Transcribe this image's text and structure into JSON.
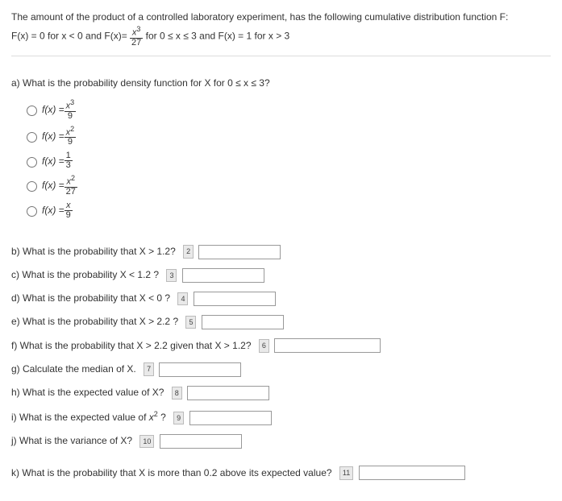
{
  "intro": {
    "line1": "The amount of the product of a controlled laboratory experiment, has the following cumulative distribution function F:",
    "line2_pre": "F(x) = 0 for x < 0 and F(x)= ",
    "line2_mid": " for 0 ≤ x ≤ 3 and F(x) = 1 for x > 3"
  },
  "a": {
    "prompt": "a) What is the probability density function for X for 0 ≤ x ≤ 3?",
    "prefix": "f(x) = "
  },
  "b": {
    "prompt": "b) What is the probability that X > 1.2?",
    "n": "2"
  },
  "c": {
    "prompt": "c) What is the probability X < 1.2 ?",
    "n": "3"
  },
  "d": {
    "prompt": "d) What is the probability that X < 0 ?",
    "n": "4"
  },
  "e": {
    "prompt": "e) What is the probability that X > 2.2 ?",
    "n": "5"
  },
  "f": {
    "prompt": "f) What is the probability that X > 2.2 given that X > 1.2?",
    "n": "6"
  },
  "g": {
    "prompt": "g) Calculate the median of X.",
    "n": "7"
  },
  "h": {
    "prompt": "h) What is the expected value of X?",
    "n": "8"
  },
  "i": {
    "prompt_pre": "i) What is the expected value of ",
    "prompt_post": " ?",
    "n": "9"
  },
  "j": {
    "prompt": "j) What is the variance of X?",
    "n": "10"
  },
  "k": {
    "prompt": "k) What is the probability that X is more than 0.2 above its expected value?",
    "n": "11"
  }
}
